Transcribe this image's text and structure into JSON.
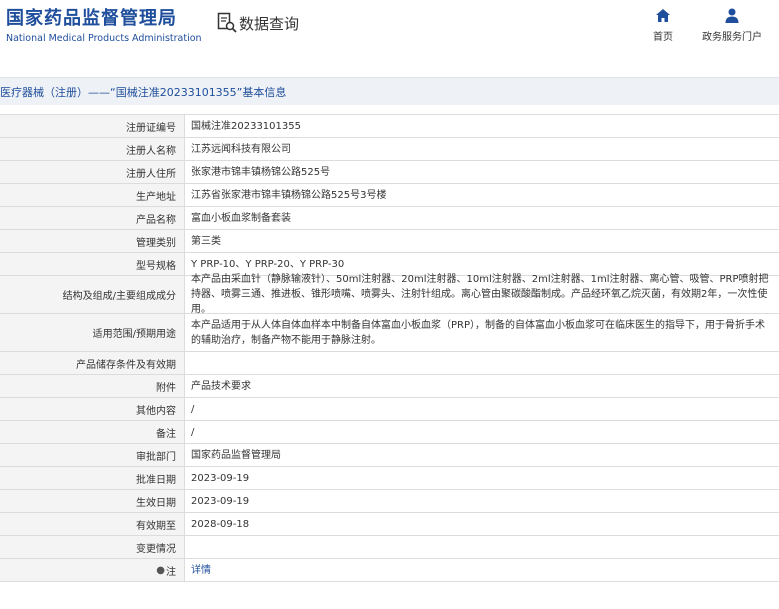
{
  "header": {
    "brand_cn": "国家药品监督管理局",
    "brand_en": "National Medical Products Administration",
    "query_label": "数据查询",
    "nav_home": "首页",
    "nav_service": "政务服务门户"
  },
  "breadcrumb": "医疗器械（注册）——“国械注准20233101355”基本信息",
  "rows": [
    {
      "label": "注册证编号",
      "value": "国械注准20233101355"
    },
    {
      "label": "注册人名称",
      "value": "江苏远闻科技有限公司"
    },
    {
      "label": "注册人住所",
      "value": "张家港市锦丰镇杨锦公路525号"
    },
    {
      "label": "生产地址",
      "value": "江苏省张家港市锦丰镇杨锦公路525号3号楼"
    },
    {
      "label": "产品名称",
      "value": "富血小板血浆制备套装"
    },
    {
      "label": "管理类别",
      "value": "第三类"
    },
    {
      "label": "型号规格",
      "value": "Y PRP-10、Y PRP-20、Y PRP-30"
    },
    {
      "label": "结构及组成/主要组成成分",
      "value": "本产品由采血针（静脉输液针）、50ml注射器、20ml注射器、10ml注射器、2ml注射器、1ml注射器、离心管、吸管、PRP喷射把持器、喷雾三通、推进板、锥形喷嘴、喷雾头、注射针组成。离心管由聚碳酸酯制成。产品经环氧乙烷灭菌，有效期2年，一次性使用。"
    },
    {
      "label": "适用范围/预期用途",
      "value": "本产品适用于从人体自体血样本中制备自体富血小板血浆（PRP），制备的自体富血小板血浆可在临床医生的指导下，用于骨折手术的辅助治疗，制备产物不能用于静脉注射。"
    },
    {
      "label": "产品储存条件及有效期",
      "value": ""
    },
    {
      "label": "附件",
      "value": "产品技术要求"
    },
    {
      "label": "其他内容",
      "value": "/"
    },
    {
      "label": "备注",
      "value": "/"
    },
    {
      "label": "审批部门",
      "value": "国家药品监督管理局"
    },
    {
      "label": "批准日期",
      "value": "2023-09-19"
    },
    {
      "label": "生效日期",
      "value": "2023-09-19"
    },
    {
      "label": "有效期至",
      "value": "2028-09-18"
    },
    {
      "label": "变更情况",
      "value": ""
    },
    {
      "label": "注",
      "value": "详情"
    }
  ],
  "colors": {
    "brand": "#1f4e9c",
    "label_bg": "#f4f4f4",
    "crumb_bg": "#eef1f5"
  },
  "icons": {
    "query": "search-document-icon",
    "home": "home-icon",
    "service": "user-icon",
    "note": "info-bulb-icon"
  }
}
